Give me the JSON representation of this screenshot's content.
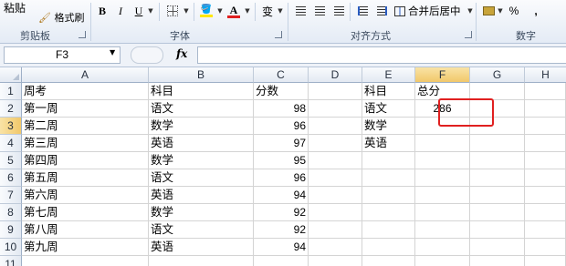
{
  "ribbon": {
    "paste_label": "粘贴",
    "format_painter_label": "格式刷",
    "clipboard_group": "剪贴板",
    "bold": "B",
    "italic": "I",
    "underline": "U",
    "font_group": "字体",
    "phonetic_label": "变",
    "wrap_label": "合并后居中",
    "alignment_group": "对齐方式",
    "percent": "%",
    "comma": ",",
    "number_group": "数字",
    "font_color": "#e02020",
    "fill_color": "#ffe800"
  },
  "formula_bar": {
    "name_box": "F3",
    "fx_label": "fx",
    "formula": ""
  },
  "grid": {
    "columns": [
      "A",
      "B",
      "C",
      "D",
      "E",
      "F",
      "G",
      "H"
    ],
    "rows": [
      "1",
      "2",
      "3",
      "4",
      "5",
      "6",
      "7",
      "8",
      "9",
      "10",
      "11"
    ],
    "header_row": {
      "week": "周考",
      "subject": "科目",
      "score": "分数",
      "e_subject": "科目",
      "f_total": "总分"
    },
    "data": [
      {
        "week": "第一周",
        "subject": "语文",
        "score": "98"
      },
      {
        "week": "第二周",
        "subject": "数学",
        "score": "96"
      },
      {
        "week": "第三周",
        "subject": "英语",
        "score": "97"
      },
      {
        "week": "第四周",
        "subject": "数学",
        "score": "95"
      },
      {
        "week": "第五周",
        "subject": "语文",
        "score": "96"
      },
      {
        "week": "第六周",
        "subject": "英语",
        "score": "94"
      },
      {
        "week": "第七周",
        "subject": "数学",
        "score": "92"
      },
      {
        "week": "第八周",
        "subject": "语文",
        "score": "92"
      },
      {
        "week": "第九周",
        "subject": "英语",
        "score": "94"
      }
    ],
    "summary": [
      {
        "subject": "语文",
        "total": "286"
      },
      {
        "subject": "数学",
        "total": ""
      },
      {
        "subject": "英语",
        "total": ""
      }
    ],
    "highlight_color": "#e02020"
  }
}
